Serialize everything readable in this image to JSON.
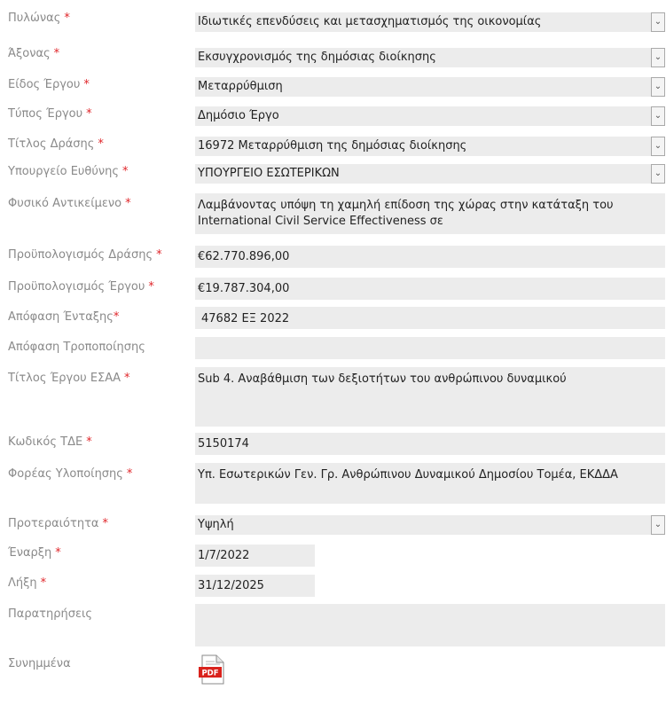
{
  "required_mark": "*",
  "fields": {
    "pylonas": {
      "label": "Πυλώνας",
      "value": "Ιδιωτικές επενδύσεις και μετασχηματισμός της οικονομίας"
    },
    "axonas": {
      "label": "Άξονας",
      "value": "Εκσυγχρονισμός της δημόσιας διοίκησης"
    },
    "eidos_ergou": {
      "label": "Είδος Έργου",
      "value": "Μεταρρύθμιση"
    },
    "typos_ergou": {
      "label": "Τύπος Έργου",
      "value": "Δημόσιο Έργο"
    },
    "titlos_drasis": {
      "label": "Τίτλος Δράσης",
      "value": "16972 Μεταρρύθμιση της δημόσιας διοίκησης"
    },
    "ypourgeio": {
      "label": "Υπουργείο Ευθύνης",
      "value": "ΥΠΟΥΡΓΕΙΟ ΕΣΩΤΕΡΙΚΩΝ"
    },
    "fysiko": {
      "label": "Φυσικό Αντικείμενο",
      "value": "Λαμβάνοντας υπόψη τη χαμηλή επίδοση της χώρας στην κατάταξη του International Civil Service Effectiveness σε"
    },
    "proyp_drasis": {
      "label": "Προϋπολογισμός Δράσης",
      "value": "€62.770.896,00"
    },
    "proyp_ergou": {
      "label": "Προϋπολογισμός Έργου",
      "value": "€19.787.304,00"
    },
    "apofasi_entaxis": {
      "label": "Απόφαση Ένταξης",
      "value": "47682 ΕΞ 2022"
    },
    "apofasi_tropopoiisis": {
      "label": "Απόφαση Τροποποίησης",
      "value": ""
    },
    "titlos_esaa": {
      "label": "Τίτλος Έργου ΕΣΑΑ",
      "value": "Sub 4. Αναβάθμιση των δεξιοτήτων του ανθρώπινου δυναμικού"
    },
    "kodikos_tde": {
      "label": "Κωδικός ΤΔΕ",
      "value": "5150174"
    },
    "foreas": {
      "label": "Φορέας Υλοποίησης",
      "value": "Υπ. Εσωτερικών Γεν. Γρ. Ανθρώπινου Δυναμικού Δημοσίου Τομέα, ΕΚΔΔΑ"
    },
    "proteraiotita": {
      "label": "Προτεραιότητα",
      "value": "Υψηλή"
    },
    "enarxi": {
      "label": "Έναρξη",
      "value": "1/7/2022"
    },
    "lixi": {
      "label": "Λήξη",
      "value": "31/12/2025"
    },
    "paratiriseis": {
      "label": "Παρατηρήσεις",
      "value": ""
    },
    "synimmena": {
      "label": "Συνημμένα"
    }
  },
  "attachment": {
    "icon": "pdf-file-icon",
    "badge": "PDF"
  },
  "icons": {
    "dropdown": "chevron-down-icon"
  },
  "colors": {
    "required": "#e0262a",
    "label": "#8a8a8a",
    "field_bg": "#ececec"
  }
}
